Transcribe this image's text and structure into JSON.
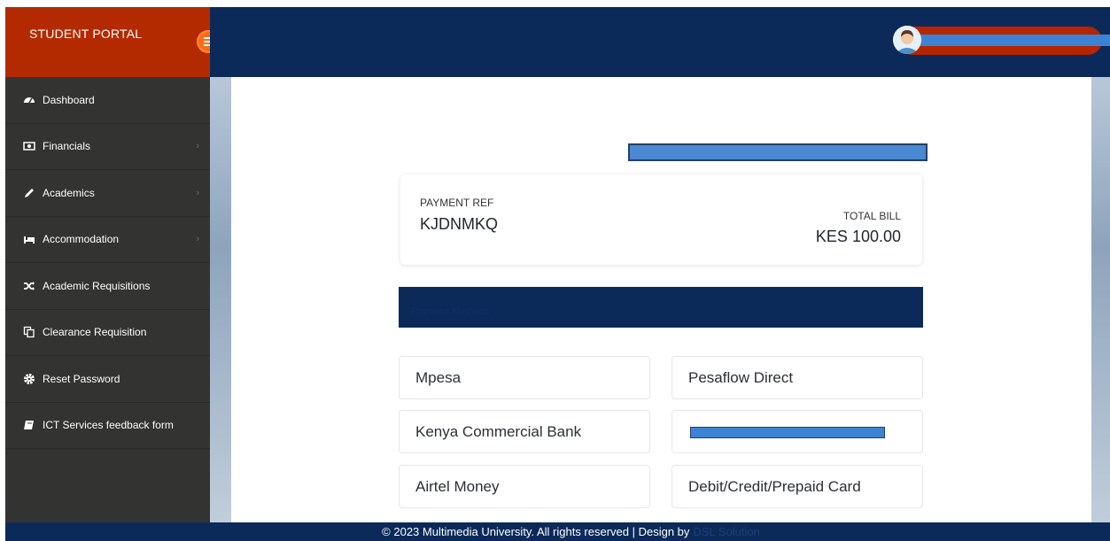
{
  "brand": {
    "title": "STUDENT PORTAL"
  },
  "sidebar": {
    "items": [
      {
        "label": "Dashboard",
        "icon": "dashboard-icon",
        "has_submenu": false
      },
      {
        "label": "Financials",
        "icon": "money-icon",
        "has_submenu": true
      },
      {
        "label": "Academics",
        "icon": "pencil-icon",
        "has_submenu": true
      },
      {
        "label": "Accommodation",
        "icon": "bed-icon",
        "has_submenu": true
      },
      {
        "label": "Academic Requisitions",
        "icon": "shuffle-icon",
        "has_submenu": false
      },
      {
        "label": "Clearance Requisition",
        "icon": "copy-icon",
        "has_submenu": false
      },
      {
        "label": "Reset Password",
        "icon": "gear-icon",
        "has_submenu": false
      },
      {
        "label": "ICT Services feedback form",
        "icon": "book-icon",
        "has_submenu": false
      }
    ]
  },
  "bill": {
    "ref_label": "PAYMENT REF",
    "ref_value": "KJDNMKQ",
    "total_label": "TOTAL BILL",
    "total_value": "KES 100.00"
  },
  "methods_header": "Payment Methods",
  "methods": [
    {
      "label": "Mpesa"
    },
    {
      "label": "Pesaflow Direct"
    },
    {
      "label": "Kenya Commercial Bank"
    },
    {
      "label": "",
      "redacted": true
    },
    {
      "label": "Airtel Money"
    },
    {
      "label": "Debit/Credit/Prepaid Card"
    }
  ],
  "footer": {
    "text": "© 2023 Multimedia University. All rights reserved | Design by",
    "link": "DSL Solution"
  },
  "colors": {
    "brand": "#b42a00",
    "header": "#0b2a5a",
    "sidebar": "#333331",
    "toggle": "#ff6a12",
    "redaction": "#3c83d4"
  }
}
